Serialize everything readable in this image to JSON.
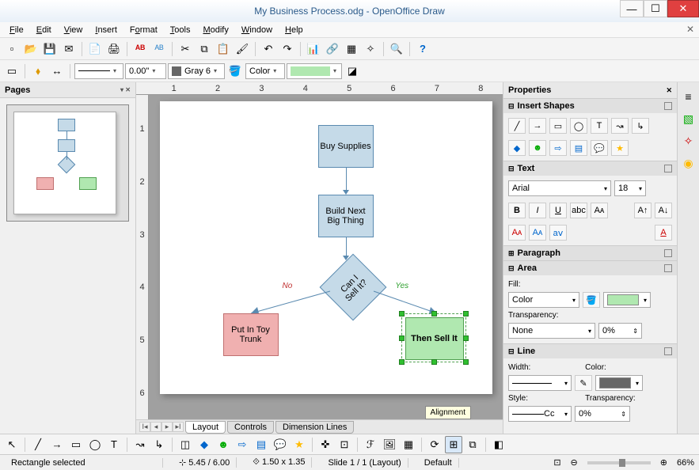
{
  "window": {
    "title": "My Business Process.odg - OpenOffice Draw"
  },
  "menus": {
    "file": "File",
    "edit": "Edit",
    "view": "View",
    "insert": "Insert",
    "format": "Format",
    "tools": "Tools",
    "modify": "Modify",
    "window": "Window",
    "help": "Help"
  },
  "toolbar2": {
    "arrow_width": "0.00\"",
    "color_name": "Gray 6",
    "fill_label": "Color"
  },
  "pages_panel": {
    "title": "Pages"
  },
  "flowchart": {
    "box1": "Buy Supplies",
    "box2": "Build Next Big Thing",
    "decision": "Can I Sell It?",
    "no_label": "No",
    "yes_label": "Yes",
    "box_no": "Put In Toy Trunk",
    "box_yes": "Then Sell It"
  },
  "bottom_tabs": {
    "layout": "Layout",
    "controls": "Controls",
    "dim": "Dimension Lines",
    "tooltip": "Alignment"
  },
  "properties": {
    "title": "Properties",
    "shapes_hdr": "Insert Shapes",
    "text_hdr": "Text",
    "font_name": "Arial",
    "font_size": "18",
    "para_hdr": "Paragraph",
    "area_hdr": "Area",
    "fill_label": "Fill:",
    "fill_type": "Color",
    "trans_label": "Transparency:",
    "trans_type": "None",
    "trans_val": "0%",
    "line_hdr": "Line",
    "width_label": "Width:",
    "color_label": "Color:",
    "style_label": "Style:",
    "style_val": "Cc",
    "line_trans_label": "Transparency:",
    "line_trans_val": "0%"
  },
  "status": {
    "selection": "Rectangle selected",
    "pos": "5.45 / 6.00",
    "size": "1.50 x 1.35",
    "slide": "Slide 1 / 1 (Layout)",
    "mode": "Default",
    "zoom": "66%"
  }
}
